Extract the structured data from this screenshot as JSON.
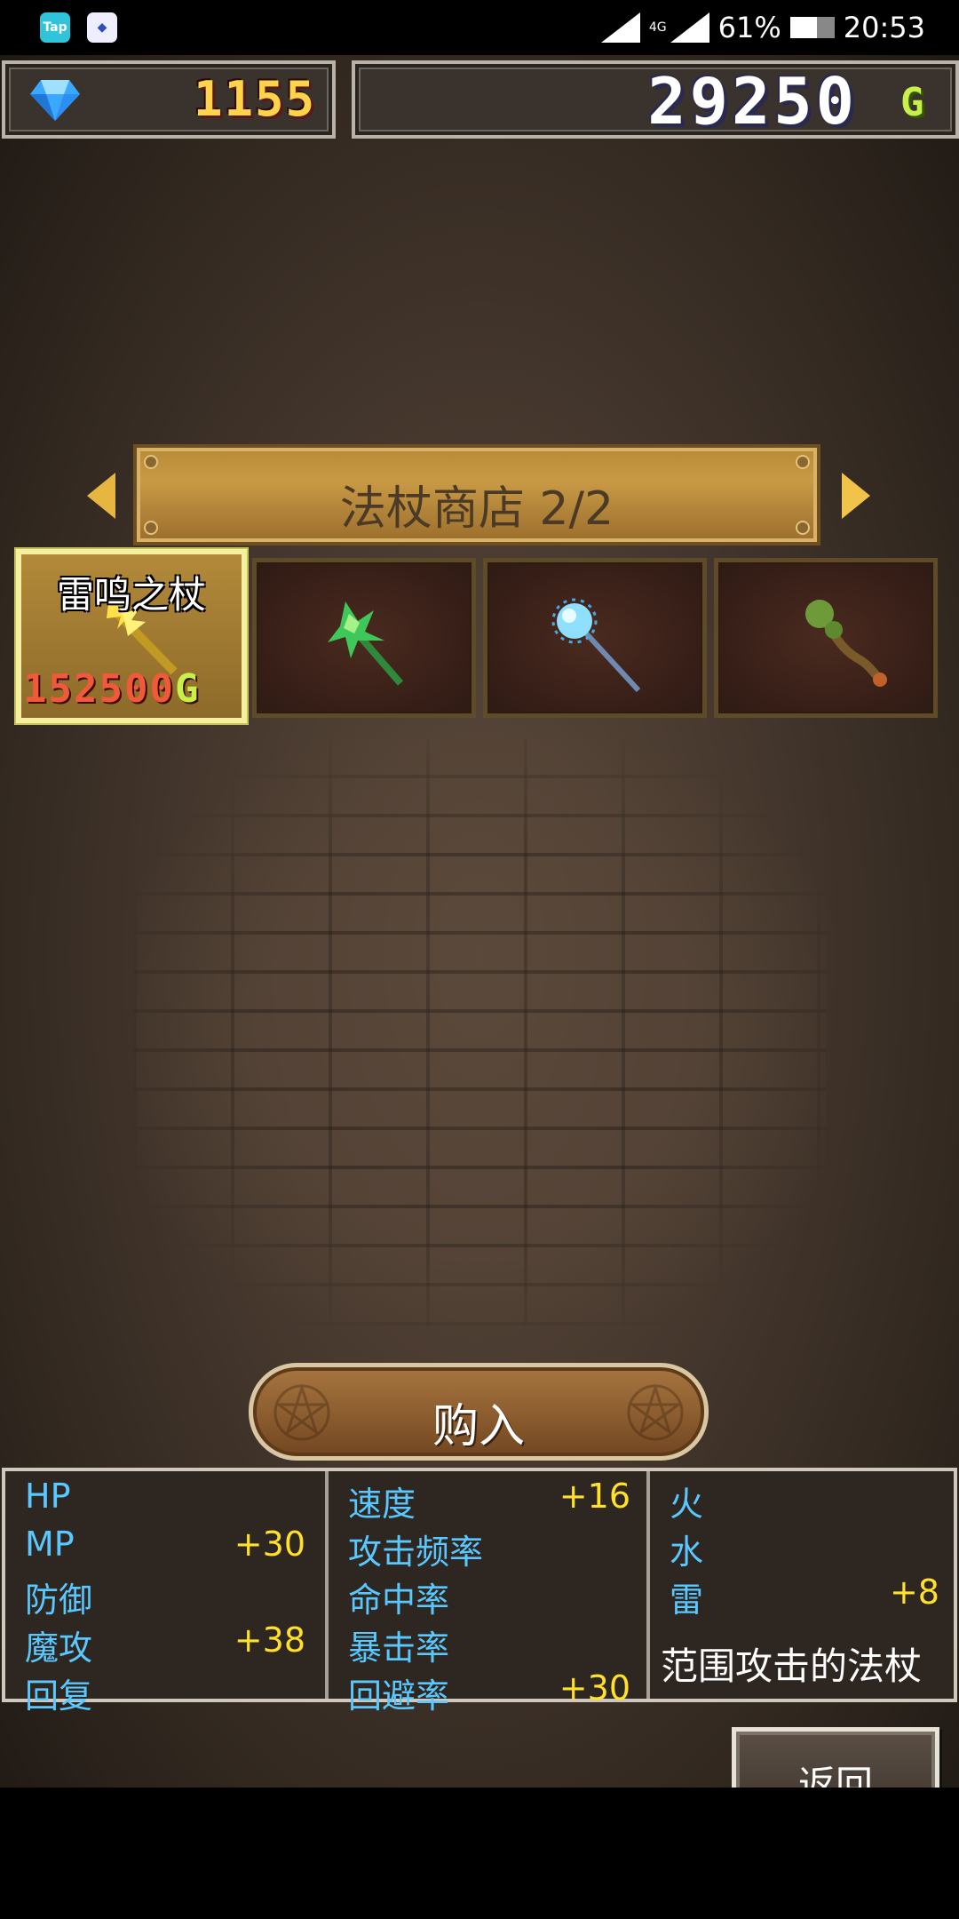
{
  "status_bar": {
    "app_icons": [
      "Tap",
      "game-app"
    ],
    "network": "4G",
    "battery": "61%",
    "battery_level": 0.61,
    "time": "20:53"
  },
  "currency": {
    "gems": "1155",
    "gold": "29250",
    "gold_unit": "G"
  },
  "shop": {
    "title": "法杖商店 2/2"
  },
  "items": [
    {
      "name": "雷鸣之杖",
      "price": "152500",
      "price_unit": "G",
      "selected": true,
      "icon": "lightning-staff-icon",
      "color": "#e8c43a"
    },
    {
      "icon": "green-leaf-staff-icon",
      "color": "#3fc85a"
    },
    {
      "icon": "ice-orb-staff-icon",
      "color": "#8fe0ff"
    },
    {
      "icon": "vine-staff-icon",
      "color": "#6f9a3a"
    }
  ],
  "buy_button": {
    "label": "购入"
  },
  "stats": {
    "col1": [
      {
        "label": "HP",
        "value": ""
      },
      {
        "label": "MP",
        "value": "+30"
      },
      {
        "label": "防御",
        "value": ""
      },
      {
        "label": "魔攻",
        "value": "+38"
      },
      {
        "label": "回复",
        "value": ""
      }
    ],
    "col2": [
      {
        "label": "速度",
        "value": "+16"
      },
      {
        "label": "攻击频率",
        "value": ""
      },
      {
        "label": "命中率",
        "value": ""
      },
      {
        "label": "暴击率",
        "value": ""
      },
      {
        "label": "回避率",
        "value": "+30"
      }
    ],
    "col3": [
      {
        "label": "火",
        "value": ""
      },
      {
        "label": "水",
        "value": ""
      },
      {
        "label": "雷",
        "value": "+8"
      }
    ],
    "description": "范围攻击的法杖"
  },
  "back_button": {
    "label": "返回"
  },
  "colors": {
    "stat_label": "#59c8ff",
    "stat_value": "#ffe02a",
    "price": "#f05a3a",
    "gem_count": "#ffd34a"
  }
}
